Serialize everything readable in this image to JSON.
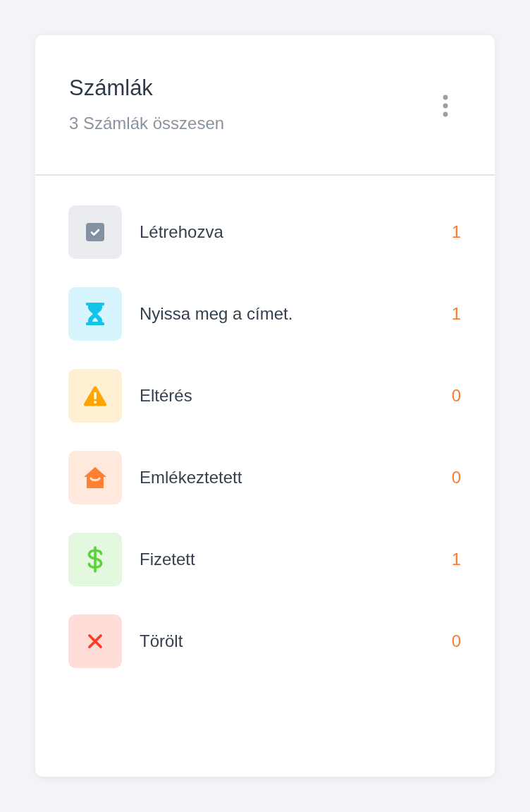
{
  "card": {
    "title": "Számlák",
    "subtitle": "3 Számlák összesen"
  },
  "items": [
    {
      "kind": "checkbox",
      "label": "Létrehozva",
      "count": "1",
      "color": "#8391a3"
    },
    {
      "kind": "hourglass",
      "label": "Nyissa meg a címet.",
      "count": "1",
      "color": "#12c3ec"
    },
    {
      "kind": "warning",
      "label": "Eltérés",
      "count": "0",
      "color": "#ffa500"
    },
    {
      "kind": "house",
      "label": "Emlékeztetett",
      "count": "0",
      "color": "#ff7f35"
    },
    {
      "kind": "dollar",
      "label": "Fizetett",
      "count": "1",
      "color": "#58d33a"
    },
    {
      "kind": "cross",
      "label": "Törölt",
      "count": "0",
      "color": "#ff3b20"
    }
  ]
}
